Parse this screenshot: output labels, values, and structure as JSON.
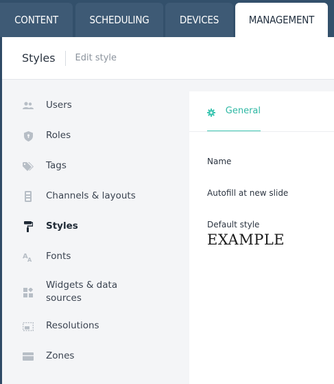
{
  "top_tabs": [
    {
      "label": "CONTENT"
    },
    {
      "label": "SCHEDULING"
    },
    {
      "label": "DEVICES"
    },
    {
      "label": "MANAGEMENT",
      "active": true
    }
  ],
  "header": {
    "title": "Styles",
    "breadcrumb": "Edit style"
  },
  "sidebar": {
    "items": [
      {
        "label": "Users",
        "icon": "users-icon"
      },
      {
        "label": "Roles",
        "icon": "shield-icon"
      },
      {
        "label": "Tags",
        "icon": "tags-icon"
      },
      {
        "label": "Channels & layouts",
        "icon": "channels-icon"
      },
      {
        "label": "Styles",
        "icon": "paint-roller-icon",
        "active": true
      },
      {
        "label": "Fonts",
        "icon": "fonts-icon"
      },
      {
        "label": "Widgets & data",
        "label2": "sources",
        "icon": "widgets-icon"
      },
      {
        "label": "Resolutions",
        "icon": "resolutions-icon"
      },
      {
        "label": "Zones",
        "icon": "zones-icon"
      }
    ]
  },
  "panel": {
    "tab_label": "General",
    "fields": {
      "name_label": "Name",
      "autofill_label": "Autofill at new slide",
      "default_style_label": "Default style",
      "default_style_preview": "EXAMPLE"
    }
  },
  "colors": {
    "topbar": "#33506b",
    "inactive_tab": "#3e5a75",
    "accent": "#3ec6b2",
    "sidebar_bg": "#f4f5f7"
  }
}
